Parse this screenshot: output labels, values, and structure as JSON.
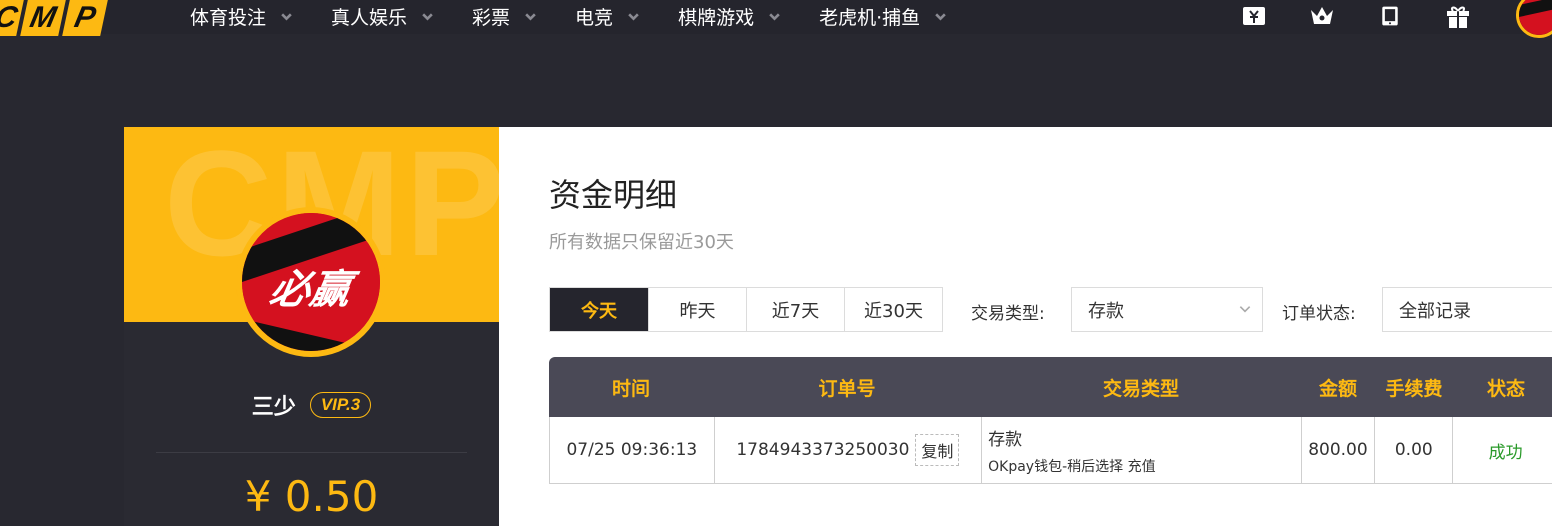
{
  "logo": {
    "letters": [
      "C",
      "M",
      "P"
    ]
  },
  "nav": {
    "items": [
      {
        "label": "体育投注"
      },
      {
        "label": "真人娱乐"
      },
      {
        "label": "彩票"
      },
      {
        "label": "电竞"
      },
      {
        "label": "棋牌游戏"
      },
      {
        "label": "老虎机·捕鱼"
      }
    ],
    "icons": [
      "ticket-icon",
      "crown-icon",
      "tablet-icon",
      "gift-icon"
    ]
  },
  "profile": {
    "banner_watermark": "CMP",
    "avatar_text": "必赢",
    "username": "三少",
    "vip": "VIP.3",
    "balance": "¥ 0.50"
  },
  "page": {
    "title": "资金明细",
    "subtitle": "所有数据只保留近30天"
  },
  "date_tabs": [
    {
      "label": "今天",
      "active": true
    },
    {
      "label": "昨天",
      "active": false
    },
    {
      "label": "近7天",
      "active": false
    },
    {
      "label": "近30天",
      "active": false
    }
  ],
  "filters": {
    "type_label": "交易类型:",
    "type_value": "存款",
    "status_label": "订单状态:",
    "status_value": "全部记录"
  },
  "table": {
    "headers": [
      "时间",
      "订单号",
      "交易类型",
      "金额",
      "手续费",
      "状态"
    ],
    "rows": [
      {
        "time": "07/25 09:36:13",
        "order_no": "1784943373250030",
        "copy_label": "复制",
        "type": "存款",
        "type_detail": "OKpay钱包-稍后选择 充值",
        "amount": "800.00",
        "fee": "0.00",
        "status": "成功"
      }
    ]
  },
  "colors": {
    "accent": "#fdb912",
    "dark": "#25252d",
    "success": "#2a9a2a",
    "header": "#4a4956"
  }
}
